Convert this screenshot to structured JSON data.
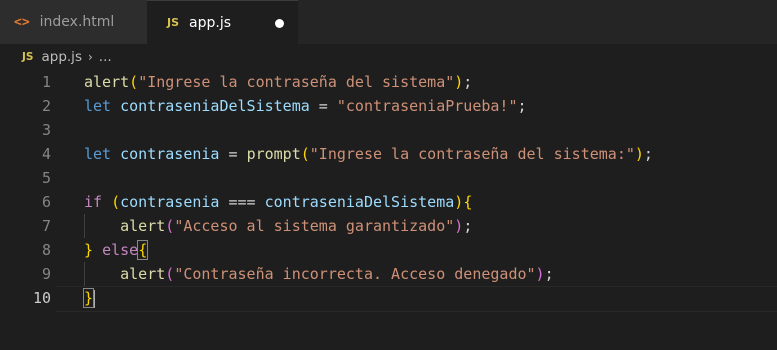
{
  "tabs": [
    {
      "icon": "html-icon",
      "icon_glyph": "<>",
      "label": "index.html",
      "active": false
    },
    {
      "icon": "js-icon",
      "icon_glyph": "JS",
      "label": "app.js",
      "active": true,
      "unsaved": true
    }
  ],
  "breadcrumb": {
    "icon_glyph": "JS",
    "file": "app.js",
    "separator": "›",
    "rest": "..."
  },
  "lines": [
    {
      "n": "1",
      "tokens": [
        [
          "fn",
          "alert"
        ],
        [
          "p1",
          "("
        ],
        [
          "str",
          "\"Ingrese la contraseña del sistema\""
        ],
        [
          "p1",
          ")"
        ],
        [
          "op",
          ";"
        ]
      ]
    },
    {
      "n": "2",
      "tokens": [
        [
          "kw",
          "let"
        ],
        [
          "op",
          " "
        ],
        [
          "var",
          "contraseniaDelSistema"
        ],
        [
          "op",
          " = "
        ],
        [
          "str",
          "\"contraseniaPrueba!\""
        ],
        [
          "op",
          ";"
        ]
      ]
    },
    {
      "n": "3",
      "tokens": []
    },
    {
      "n": "4",
      "tokens": [
        [
          "kw",
          "let"
        ],
        [
          "op",
          " "
        ],
        [
          "var",
          "contrasenia"
        ],
        [
          "op",
          " = "
        ],
        [
          "fn",
          "prompt"
        ],
        [
          "p1",
          "("
        ],
        [
          "str",
          "\"Ingrese la contraseña del sistema:\""
        ],
        [
          "p1",
          ")"
        ],
        [
          "op",
          ";"
        ]
      ]
    },
    {
      "n": "5",
      "tokens": []
    },
    {
      "n": "6",
      "tokens": [
        [
          "ctl",
          "if"
        ],
        [
          "op",
          " "
        ],
        [
          "p1",
          "("
        ],
        [
          "var",
          "contrasenia"
        ],
        [
          "op",
          " === "
        ],
        [
          "var",
          "contraseniaDelSistema"
        ],
        [
          "p1",
          ")"
        ],
        [
          "p1",
          "{"
        ]
      ]
    },
    {
      "n": "7",
      "tokens": [
        [
          "op",
          "    "
        ],
        [
          "fn",
          "alert"
        ],
        [
          "p2",
          "("
        ],
        [
          "str",
          "\"Acceso al sistema garantizado\""
        ],
        [
          "p2",
          ")"
        ],
        [
          "op",
          ";"
        ]
      ]
    },
    {
      "n": "8",
      "tokens": [
        [
          "p1",
          "}"
        ],
        [
          "op",
          " "
        ],
        [
          "ctl",
          "else"
        ],
        [
          "p1b",
          "{"
        ]
      ]
    },
    {
      "n": "9",
      "tokens": [
        [
          "op",
          "    "
        ],
        [
          "fn",
          "alert"
        ],
        [
          "p2",
          "("
        ],
        [
          "str",
          "\"Contraseña incorrecta. Acceso denegado\""
        ],
        [
          "p2",
          ")"
        ],
        [
          "op",
          ";"
        ]
      ]
    },
    {
      "n": "10",
      "tokens": [
        [
          "p1b",
          "}"
        ],
        [
          "caret",
          ""
        ]
      ]
    }
  ],
  "colors": {
    "background": "#1e1e1e",
    "function": "#dcdcaa",
    "string": "#ce9178",
    "keyword": "#569cd6",
    "control": "#c586c0",
    "variable": "#9cdcfe",
    "bracket_1": "#ffd700",
    "bracket_2": "#da70d6"
  },
  "current_line": "10"
}
